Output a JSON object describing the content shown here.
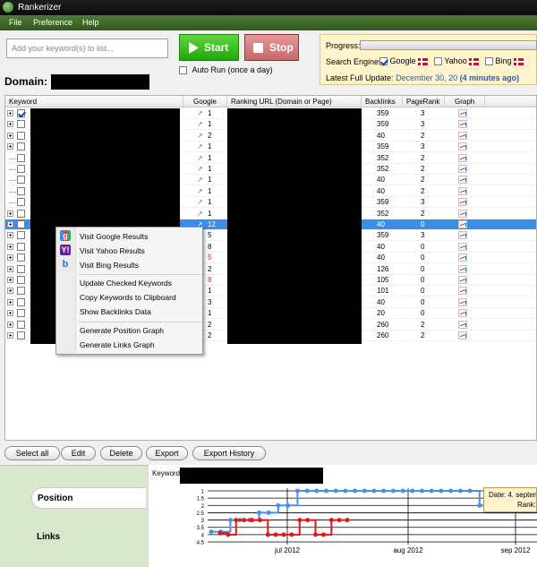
{
  "window": {
    "title": "Rankerizer"
  },
  "menu": [
    "File",
    "Preference",
    "Help"
  ],
  "toolbar": {
    "keyword_placeholder": "Add your keyword(s) to list...",
    "start_label": "Start",
    "stop_label": "Stop",
    "autorun_label": "Auto Run (once a day)",
    "domain_label": "Domain:"
  },
  "status": {
    "progress_label": "Progress:",
    "engines_label": "Search Engines:",
    "engines": [
      {
        "name": "Google",
        "checked": true
      },
      {
        "name": "Yahoo",
        "checked": false
      },
      {
        "name": "Bing",
        "checked": false
      }
    ],
    "update_label": "Latest Full Update:",
    "update_date": "December 30, 20",
    "update_ago": "(4 minutes ago)",
    "progress": 0
  },
  "grid": {
    "columns": [
      "Keyword",
      "Google",
      "Ranking URL (Domain or Page)",
      "Backlinks",
      "PageRank",
      "Graph"
    ],
    "rows": [
      {
        "google": "1",
        "backlinks": "359",
        "pagerank": "3",
        "checked": true,
        "expander": true
      },
      {
        "google": "1",
        "backlinks": "359",
        "pagerank": "3",
        "expander": true
      },
      {
        "google": "2",
        "backlinks": "40",
        "pagerank": "2",
        "expander": true
      },
      {
        "google": "1",
        "backlinks": "359",
        "pagerank": "3",
        "expander": true
      },
      {
        "google": "1",
        "backlinks": "352",
        "pagerank": "2",
        "expander": false
      },
      {
        "google": "1",
        "backlinks": "352",
        "pagerank": "2",
        "expander": false
      },
      {
        "google": "1",
        "backlinks": "40",
        "pagerank": "2",
        "expander": false
      },
      {
        "google": "1",
        "backlinks": "40",
        "pagerank": "2",
        "expander": false
      },
      {
        "google": "1",
        "backlinks": "359",
        "pagerank": "3",
        "expander": false
      },
      {
        "google": "1",
        "backlinks": "352",
        "pagerank": "2",
        "expander": true
      },
      {
        "google": "12",
        "backlinks": "40",
        "pagerank": "0",
        "expander": true,
        "selected": true
      },
      {
        "google": "5",
        "backlinks": "359",
        "pagerank": "3",
        "expander": true
      },
      {
        "google": "8",
        "backlinks": "40",
        "pagerank": "0",
        "expander": true
      },
      {
        "google": "5",
        "backlinks": "40",
        "pagerank": "0",
        "expander": true,
        "red": true
      },
      {
        "google": "2",
        "backlinks": "126",
        "pagerank": "0",
        "expander": true
      },
      {
        "google": "8",
        "backlinks": "105",
        "pagerank": "0",
        "expander": true,
        "red": true
      },
      {
        "google": "1",
        "backlinks": "101",
        "pagerank": "0",
        "expander": true
      },
      {
        "google": "3",
        "backlinks": "40",
        "pagerank": "0",
        "expander": true
      },
      {
        "google": "1",
        "backlinks": "20",
        "pagerank": "0",
        "expander": true
      },
      {
        "google": "2",
        "backlinks": "260",
        "pagerank": "2",
        "expander": true
      },
      {
        "google": "2",
        "backlinks": "260",
        "pagerank": "2",
        "expander": true
      }
    ]
  },
  "context_menu": [
    {
      "label": "Visit Google Results",
      "icon": "google-icon"
    },
    {
      "label": "Visit Yahoo Results",
      "icon": "yahoo-icon"
    },
    {
      "label": "Visit Bing Results",
      "icon": "bing-icon"
    },
    {
      "label": "Update Checked Keywords"
    },
    {
      "label": "Copy Keywords to Clipboard"
    },
    {
      "label": "Show Backlinks Data"
    },
    {
      "label": "Generate Position Graph"
    },
    {
      "label": "Generate Links Graph"
    }
  ],
  "buttons": [
    "Select all",
    "Edit",
    "Delete",
    "Export",
    "Export History"
  ],
  "tabs": [
    {
      "label": "Position",
      "active": true
    },
    {
      "label": "Links",
      "active": false
    }
  ],
  "graph": {
    "keyword_label": "Keyword:",
    "tooltip_date": "Date: 4. septem",
    "tooltip_rank": "Rank:"
  },
  "chart_data": {
    "type": "line",
    "y_ticks": [
      "1",
      "1.5",
      "2",
      "2.5",
      "3",
      "3.5",
      "4",
      "4.5"
    ],
    "ylim": [
      1,
      4.5
    ],
    "x_ticks": [
      "jul 2012",
      "aug 2012",
      "sep 2012"
    ],
    "series": [
      {
        "color": "#4a90e2",
        "values": [
          3.8,
          3.8,
          3.0,
          3.0,
          3.0,
          2.5,
          2.5,
          2.0,
          2.0,
          1.0,
          1.0,
          1.0,
          1.0,
          1.0,
          1.0,
          1.0,
          1.0,
          1.0,
          1.0,
          1.0,
          1.0,
          1.0,
          1.0,
          1.0,
          1.0,
          1.0,
          1.0,
          1.0,
          2.0,
          2.0,
          2.0,
          1.0,
          1.0,
          1.0,
          1.0
        ]
      },
      {
        "color": "#e01818",
        "values": [
          3.9,
          4.0,
          3.0,
          3.0,
          3.0,
          3.0,
          4.0,
          4.0,
          4.0,
          4.0,
          3.0,
          3.0,
          4.0,
          4.0,
          3.0,
          3.0,
          3.0
        ]
      }
    ],
    "colors": {
      "blue": "#4a90e2",
      "red": "#e01818"
    }
  }
}
